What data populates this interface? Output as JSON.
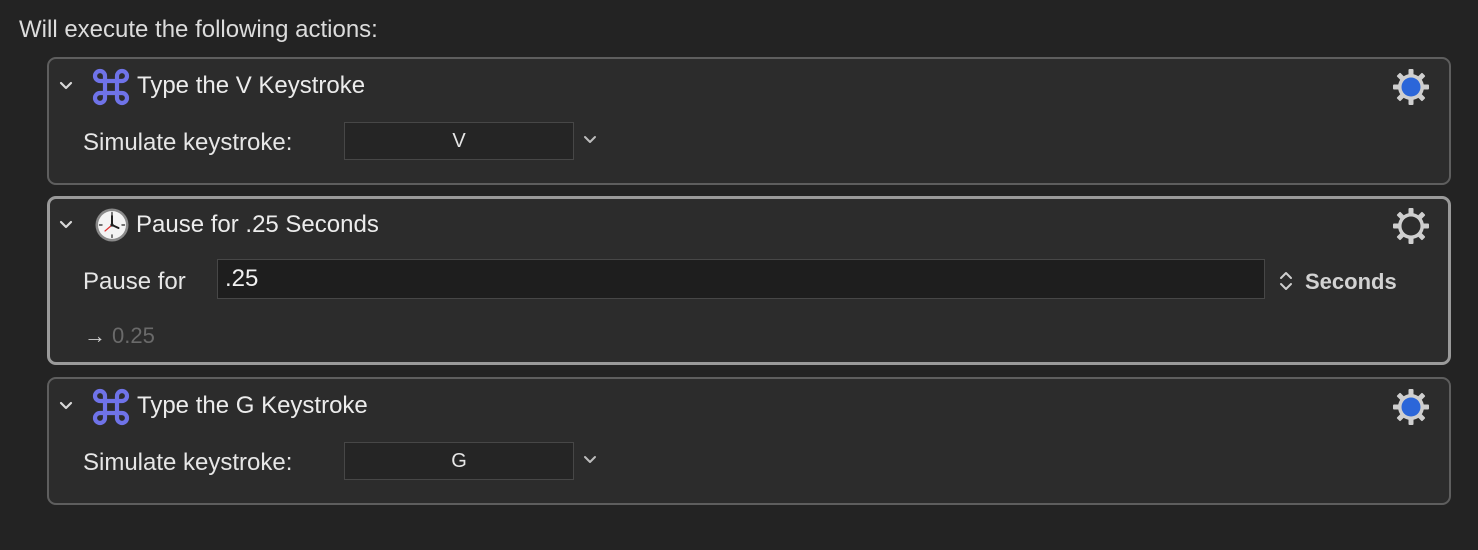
{
  "heading": "Will execute the following actions:",
  "actions": [
    {
      "title": "Type the V Keystroke",
      "icon": "command-key-icon",
      "field_label": "Simulate keystroke:",
      "keystroke": "V"
    },
    {
      "title": "Pause for .25 Seconds",
      "icon": "clock-icon",
      "field_label": "Pause for",
      "value": ".25",
      "units": "Seconds",
      "result_arrow": "→",
      "result": "0.25"
    },
    {
      "title": "Type the G Keystroke",
      "icon": "command-key-icon",
      "field_label": "Simulate keystroke:",
      "keystroke": "G"
    }
  ],
  "colors": {
    "background": "#232323",
    "panel": "#2c2c2c",
    "command_icon": "#6f73e8",
    "gear_dot": "#2b66d9"
  }
}
